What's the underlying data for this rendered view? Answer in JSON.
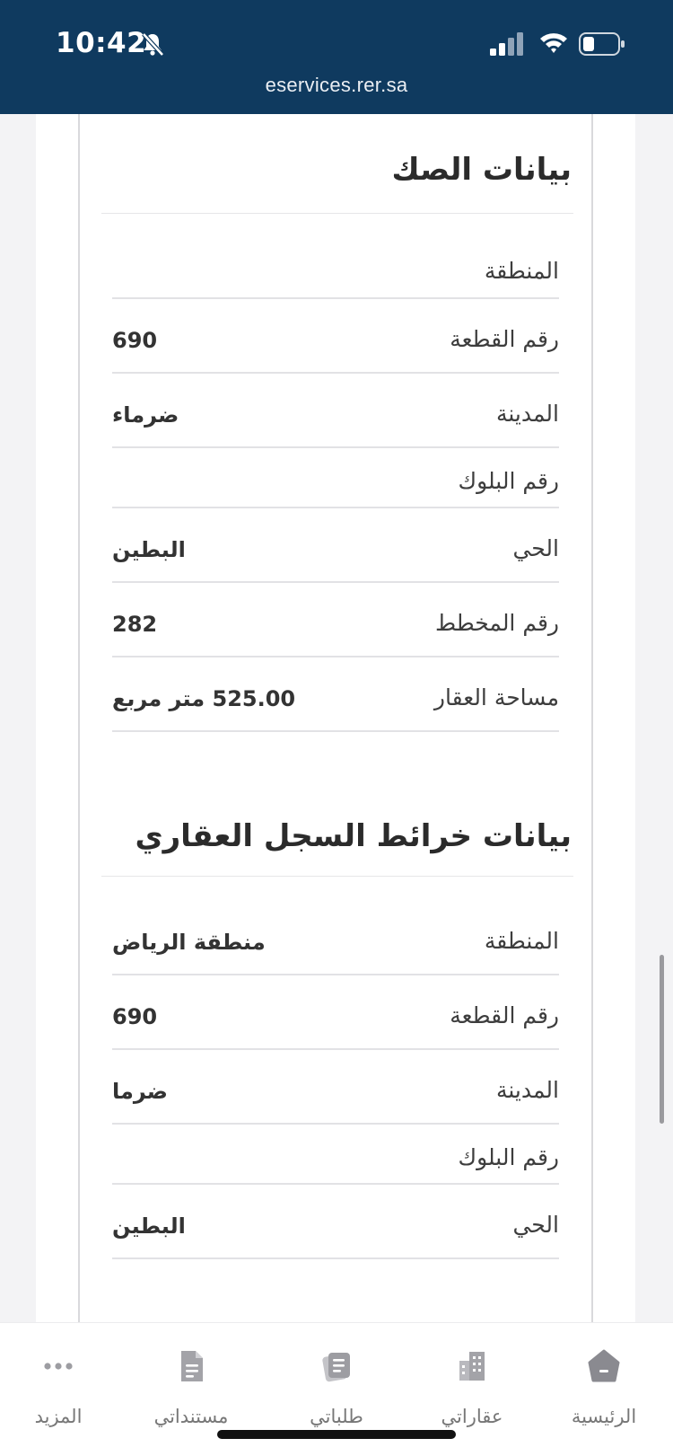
{
  "status_bar": {
    "time": "10:42",
    "url": "eservices.rer.sa",
    "background": "#0f3a5f"
  },
  "deed_section": {
    "title": "بيانات الصك",
    "rows": [
      {
        "label": "المنطقة",
        "value": ""
      },
      {
        "label": "رقم القطعة",
        "value": "690"
      },
      {
        "label": "المدينة",
        "value": "ضرماء"
      },
      {
        "label": "رقم البلوك",
        "value": ""
      },
      {
        "label": "الحي",
        "value": "البطين"
      },
      {
        "label": "رقم المخطط",
        "value": "282"
      },
      {
        "label": "مساحة العقار",
        "value": "525.00 متر مربع"
      }
    ]
  },
  "maps_section": {
    "title": "بيانات خرائط السجل العقاري",
    "rows": [
      {
        "label": "المنطقة",
        "value": "منطقة الرياض"
      },
      {
        "label": "رقم القطعة",
        "value": "690"
      },
      {
        "label": "المدينة",
        "value": "ضرما"
      },
      {
        "label": "رقم البلوك",
        "value": ""
      },
      {
        "label": "الحي",
        "value": "البطين"
      }
    ]
  },
  "bottom_nav": {
    "items": [
      {
        "label": "الرئيسية",
        "icon": "home-icon"
      },
      {
        "label": "عقاراتي",
        "icon": "buildings-icon"
      },
      {
        "label": "طلباتي",
        "icon": "requests-icon"
      },
      {
        "label": "مستنداتي",
        "icon": "document-icon"
      },
      {
        "label": "المزيد",
        "icon": "more-icon"
      }
    ]
  }
}
